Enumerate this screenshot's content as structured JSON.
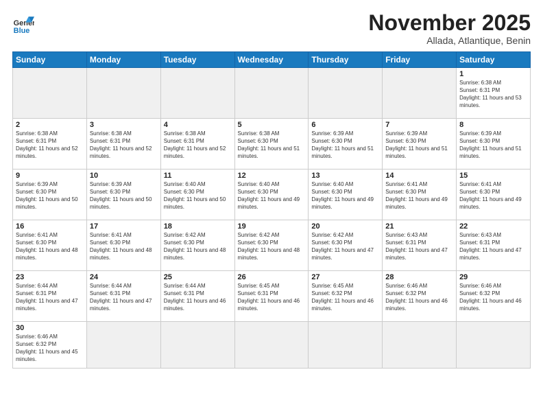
{
  "header": {
    "logo_general": "General",
    "logo_blue": "Blue",
    "month_title": "November 2025",
    "location": "Allada, Atlantique, Benin"
  },
  "days_of_week": [
    "Sunday",
    "Monday",
    "Tuesday",
    "Wednesday",
    "Thursday",
    "Friday",
    "Saturday"
  ],
  "weeks": [
    [
      {
        "day": "",
        "empty": true
      },
      {
        "day": "",
        "empty": true
      },
      {
        "day": "",
        "empty": true
      },
      {
        "day": "",
        "empty": true
      },
      {
        "day": "",
        "empty": true
      },
      {
        "day": "",
        "empty": true
      },
      {
        "day": "1",
        "sunrise": "6:38 AM",
        "sunset": "6:31 PM",
        "daylight": "11 hours and 53 minutes."
      }
    ],
    [
      {
        "day": "2",
        "sunrise": "6:38 AM",
        "sunset": "6:31 PM",
        "daylight": "11 hours and 52 minutes."
      },
      {
        "day": "3",
        "sunrise": "6:38 AM",
        "sunset": "6:31 PM",
        "daylight": "11 hours and 52 minutes."
      },
      {
        "day": "4",
        "sunrise": "6:38 AM",
        "sunset": "6:31 PM",
        "daylight": "11 hours and 52 minutes."
      },
      {
        "day": "5",
        "sunrise": "6:38 AM",
        "sunset": "6:30 PM",
        "daylight": "11 hours and 51 minutes."
      },
      {
        "day": "6",
        "sunrise": "6:39 AM",
        "sunset": "6:30 PM",
        "daylight": "11 hours and 51 minutes."
      },
      {
        "day": "7",
        "sunrise": "6:39 AM",
        "sunset": "6:30 PM",
        "daylight": "11 hours and 51 minutes."
      },
      {
        "day": "8",
        "sunrise": "6:39 AM",
        "sunset": "6:30 PM",
        "daylight": "11 hours and 51 minutes."
      }
    ],
    [
      {
        "day": "9",
        "sunrise": "6:39 AM",
        "sunset": "6:30 PM",
        "daylight": "11 hours and 50 minutes."
      },
      {
        "day": "10",
        "sunrise": "6:39 AM",
        "sunset": "6:30 PM",
        "daylight": "11 hours and 50 minutes."
      },
      {
        "day": "11",
        "sunrise": "6:40 AM",
        "sunset": "6:30 PM",
        "daylight": "11 hours and 50 minutes."
      },
      {
        "day": "12",
        "sunrise": "6:40 AM",
        "sunset": "6:30 PM",
        "daylight": "11 hours and 49 minutes."
      },
      {
        "day": "13",
        "sunrise": "6:40 AM",
        "sunset": "6:30 PM",
        "daylight": "11 hours and 49 minutes."
      },
      {
        "day": "14",
        "sunrise": "6:41 AM",
        "sunset": "6:30 PM",
        "daylight": "11 hours and 49 minutes."
      },
      {
        "day": "15",
        "sunrise": "6:41 AM",
        "sunset": "6:30 PM",
        "daylight": "11 hours and 49 minutes."
      }
    ],
    [
      {
        "day": "16",
        "sunrise": "6:41 AM",
        "sunset": "6:30 PM",
        "daylight": "11 hours and 48 minutes."
      },
      {
        "day": "17",
        "sunrise": "6:41 AM",
        "sunset": "6:30 PM",
        "daylight": "11 hours and 48 minutes."
      },
      {
        "day": "18",
        "sunrise": "6:42 AM",
        "sunset": "6:30 PM",
        "daylight": "11 hours and 48 minutes."
      },
      {
        "day": "19",
        "sunrise": "6:42 AM",
        "sunset": "6:30 PM",
        "daylight": "11 hours and 48 minutes."
      },
      {
        "day": "20",
        "sunrise": "6:42 AM",
        "sunset": "6:30 PM",
        "daylight": "11 hours and 47 minutes."
      },
      {
        "day": "21",
        "sunrise": "6:43 AM",
        "sunset": "6:31 PM",
        "daylight": "11 hours and 47 minutes."
      },
      {
        "day": "22",
        "sunrise": "6:43 AM",
        "sunset": "6:31 PM",
        "daylight": "11 hours and 47 minutes."
      }
    ],
    [
      {
        "day": "23",
        "sunrise": "6:44 AM",
        "sunset": "6:31 PM",
        "daylight": "11 hours and 47 minutes."
      },
      {
        "day": "24",
        "sunrise": "6:44 AM",
        "sunset": "6:31 PM",
        "daylight": "11 hours and 47 minutes."
      },
      {
        "day": "25",
        "sunrise": "6:44 AM",
        "sunset": "6:31 PM",
        "daylight": "11 hours and 46 minutes."
      },
      {
        "day": "26",
        "sunrise": "6:45 AM",
        "sunset": "6:31 PM",
        "daylight": "11 hours and 46 minutes."
      },
      {
        "day": "27",
        "sunrise": "6:45 AM",
        "sunset": "6:32 PM",
        "daylight": "11 hours and 46 minutes."
      },
      {
        "day": "28",
        "sunrise": "6:46 AM",
        "sunset": "6:32 PM",
        "daylight": "11 hours and 46 minutes."
      },
      {
        "day": "29",
        "sunrise": "6:46 AM",
        "sunset": "6:32 PM",
        "daylight": "11 hours and 46 minutes."
      }
    ],
    [
      {
        "day": "30",
        "sunrise": "6:46 AM",
        "sunset": "6:32 PM",
        "daylight": "11 hours and 45 minutes."
      },
      {
        "day": "",
        "empty": true
      },
      {
        "day": "",
        "empty": true
      },
      {
        "day": "",
        "empty": true
      },
      {
        "day": "",
        "empty": true
      },
      {
        "day": "",
        "empty": true
      },
      {
        "day": "",
        "empty": true
      }
    ]
  ],
  "labels": {
    "sunrise": "Sunrise:",
    "sunset": "Sunset:",
    "daylight": "Daylight:"
  }
}
